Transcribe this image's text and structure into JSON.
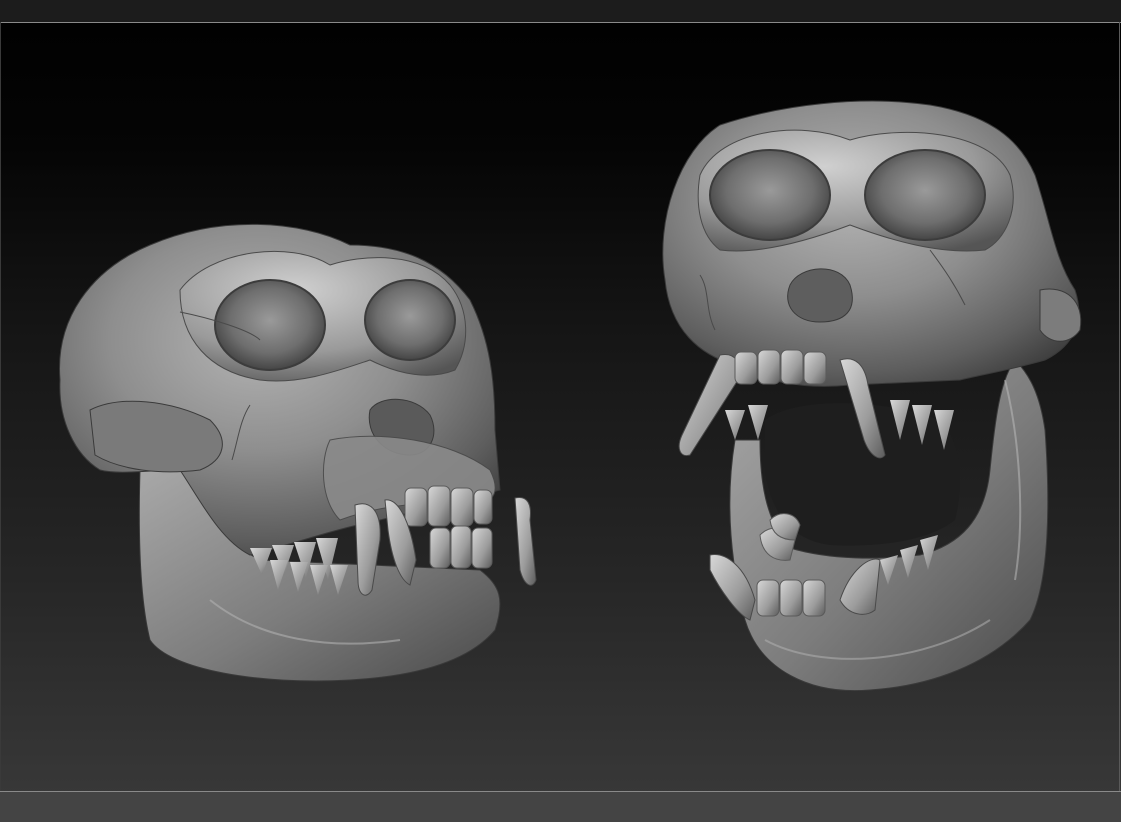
{
  "viewport": {
    "description_free": true,
    "models": [
      {
        "name": "skull-closed-jaw",
        "icon": "skull-icon"
      },
      {
        "name": "skull-open-jaw",
        "icon": "skull-icon"
      }
    ]
  },
  "colors": {
    "background_top": "#000000",
    "background_bottom": "#3a3a3a",
    "material": "#8c8c8c",
    "frame_line": "#8a8a8a"
  }
}
